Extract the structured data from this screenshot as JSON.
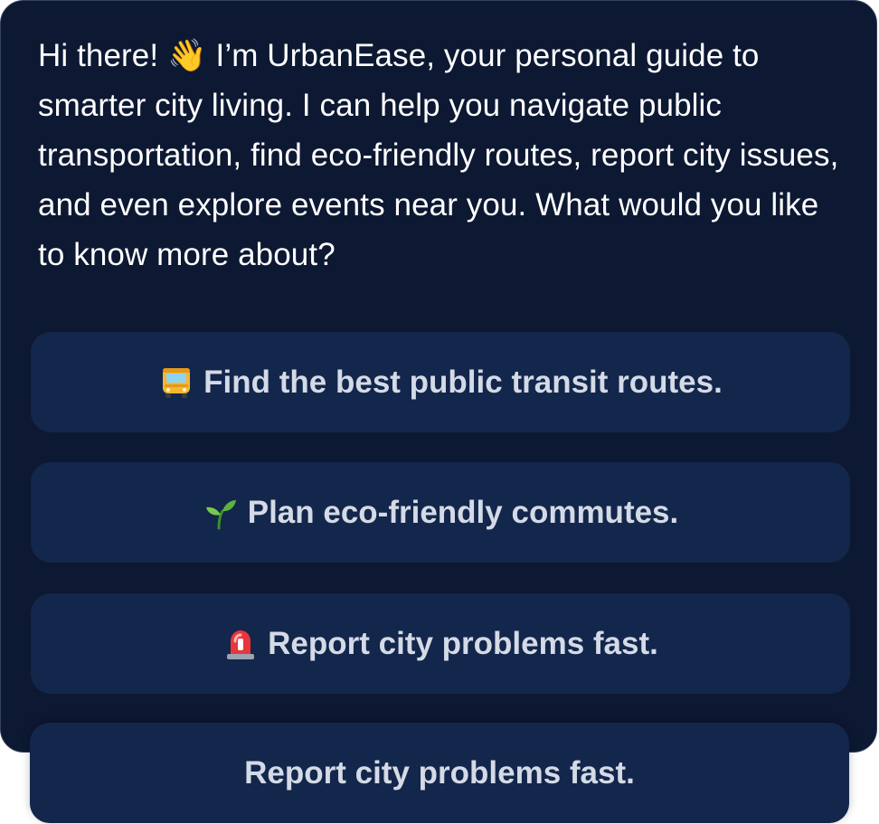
{
  "message": {
    "text": "Hi there! 👋 I’m UrbanEase, your personal guide to smarter city living. I can help you navigate public transportation, find eco-friendly routes, report city issues, and even explore events near you. What would you like to know more about?"
  },
  "suggestions": [
    {
      "icon": "bus-icon",
      "label": "Find the best public transit routes."
    },
    {
      "icon": "seedling-icon",
      "label": "Plan eco-friendly commutes."
    },
    {
      "icon": "siren-icon",
      "label": "Report city problems fast."
    },
    {
      "icon": "",
      "label": "Report city problems fast."
    }
  ],
  "colors": {
    "card_background": "#0d1832",
    "card_border": "#35425e",
    "button_background": "#13264b",
    "message_text": "#ffffff",
    "button_text": "#d4dae6"
  }
}
